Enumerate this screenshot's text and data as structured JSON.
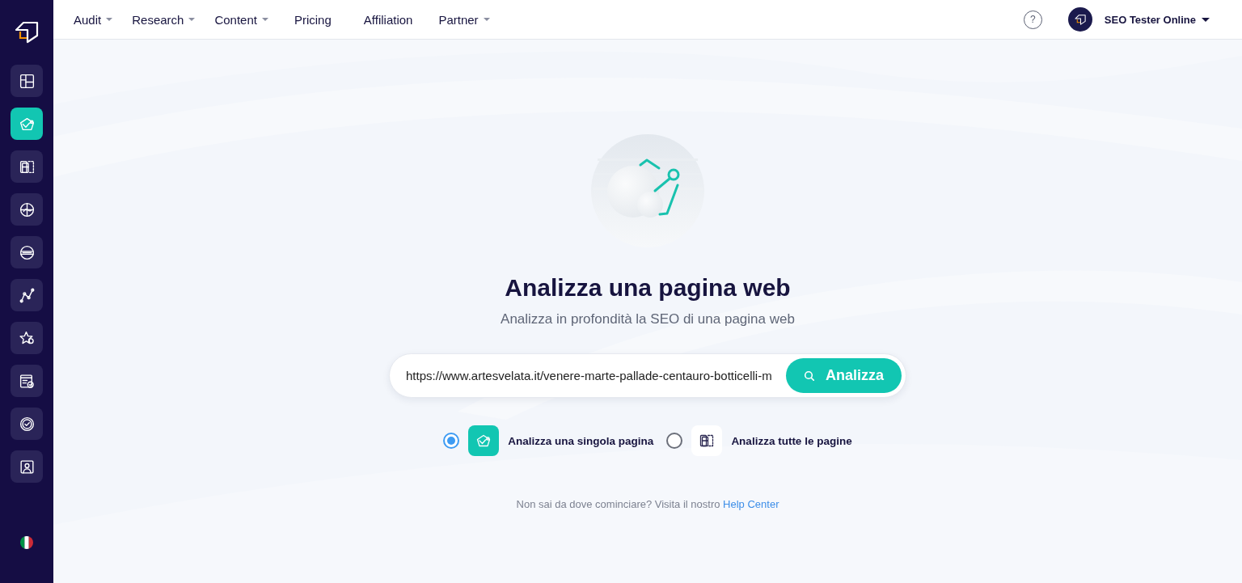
{
  "sidebar": {
    "items": [
      {
        "selected": false
      },
      {
        "selected": true
      },
      {
        "selected": false
      },
      {
        "selected": false
      },
      {
        "selected": false
      },
      {
        "selected": false
      },
      {
        "selected": false
      },
      {
        "selected": false
      },
      {
        "selected": false
      },
      {
        "selected": false
      }
    ]
  },
  "nav": {
    "items": [
      {
        "label": "Audit",
        "dropdown": true
      },
      {
        "label": "Research",
        "dropdown": true
      },
      {
        "label": "Content",
        "dropdown": true
      },
      {
        "label": "Pricing",
        "dropdown": false
      },
      {
        "label": "Affiliation",
        "dropdown": false
      },
      {
        "label": "Partner",
        "dropdown": true
      }
    ],
    "help": "?",
    "user": {
      "name": "SEO Tester Online",
      "dropdown": true
    }
  },
  "hero": {
    "title": "Analizza una pagina web",
    "subtitle": "Analizza in profondità la SEO di una pagina web"
  },
  "search": {
    "value": "https://www.artesvelata.it/venere-marte-pallade-centauro-botticelli-m",
    "button": "Analizza"
  },
  "scope_options": [
    {
      "label": "Analizza una singola pagina",
      "selected": true
    },
    {
      "label": "Analizza tutte le pagine",
      "selected": false
    }
  ],
  "help_note": {
    "text": "Non sai da dove cominciare? Visita il nostro",
    "link": "Help Center"
  }
}
